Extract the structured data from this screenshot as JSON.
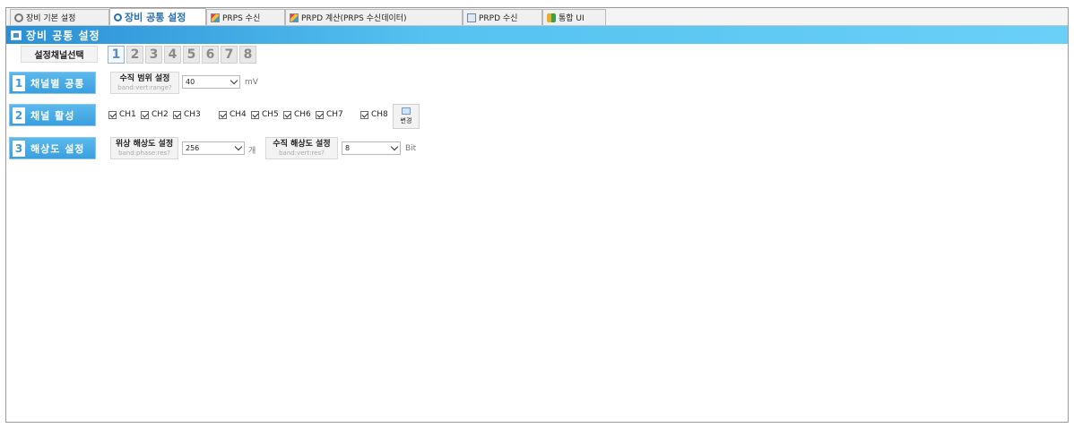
{
  "tabs": [
    {
      "label": "장비 기본 설정",
      "icon": "gear-icon",
      "active": false
    },
    {
      "label": "장비 공통 설정",
      "icon": "search-icon",
      "active": true
    },
    {
      "label": "PRPS 수신",
      "icon": "chart-icon",
      "active": false
    },
    {
      "label": "PRPD 계산(PRPS 수신데이터)",
      "icon": "chart-icon",
      "active": false
    },
    {
      "label": "PRPD 수신",
      "icon": "monitor-icon",
      "active": false
    },
    {
      "label": "통합 UI",
      "icon": "merge-icon",
      "active": false
    }
  ],
  "title": "장비 공통 설정",
  "channel_select": {
    "label": "설정채널선택",
    "channels": [
      "1",
      "2",
      "3",
      "4",
      "5",
      "6",
      "7",
      "8"
    ],
    "selected": "1"
  },
  "section1": {
    "number": "1",
    "label": "채널별 공통",
    "param_title": "수직 범위 설정",
    "param_sub": "band:vert:range?",
    "value": "40",
    "unit": "mV"
  },
  "section2": {
    "number": "2",
    "label": "채널 활성",
    "channels": [
      "CH1",
      "CH2",
      "CH3",
      "CH4",
      "CH5",
      "CH6",
      "CH7",
      "CH8"
    ],
    "change_label": "변경"
  },
  "section3": {
    "number": "3",
    "label": "해상도 설정",
    "phase_title": "위상 해상도 설정",
    "phase_sub": "band:phase:res?",
    "phase_value": "256",
    "phase_unit": "개",
    "vert_title": "수직 해상도 설정",
    "vert_sub": "band:vert:res?",
    "vert_value": "8",
    "vert_unit": "Bit"
  }
}
